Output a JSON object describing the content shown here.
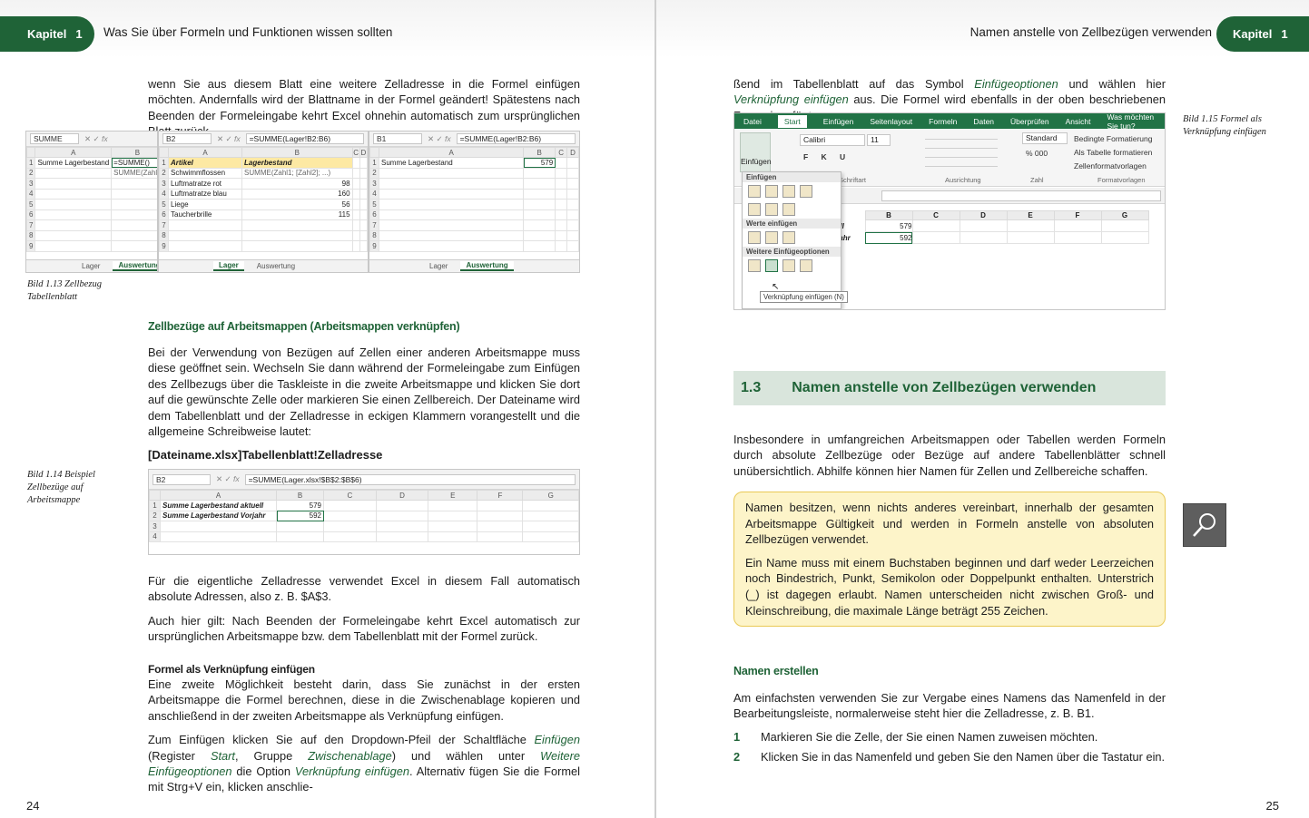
{
  "left_page": {
    "chapter_label": "Kapitel",
    "chapter_number": "1",
    "header_title": "Was Sie über Formeln und Funktionen wissen sollten",
    "intro_paragraph": "wenn Sie aus diesem Blatt eine weitere Zelladresse in die Formel einfügen möchten. Andernfalls wird der Blattname in der Formel geändert! Spätestens nach Beenden der Formeleingabe kehrt Excel ohnehin automatisch zum ursprünglichen Blatt zurück.",
    "fig113": {
      "caption": "Bild 1.13 Zellbezug Tabellenblatt",
      "panel1": {
        "namebox": "SUMME",
        "formula": "",
        "headers": [
          "A",
          "B"
        ],
        "rows": [
          [
            "1",
            "Summe Lagerbestand",
            "=SUMME()"
          ],
          [
            "2",
            "",
            "SUMME(Zahl1"
          ],
          [
            "3",
            "",
            ""
          ],
          [
            "4",
            "",
            ""
          ],
          [
            "5",
            "",
            ""
          ],
          [
            "6",
            "",
            ""
          ],
          [
            "7",
            "",
            ""
          ],
          [
            "8",
            "",
            ""
          ],
          [
            "9",
            "",
            ""
          ]
        ],
        "tabs": [
          "Lager",
          "Auswertung"
        ]
      },
      "panel2": {
        "namebox": "B2",
        "formula": "=SUMME(Lager!B2:B6)",
        "headers": [
          "A",
          "B",
          "C",
          "D"
        ],
        "rows": [
          [
            "1",
            "Artikel",
            "Lagerbestand",
            "",
            ""
          ],
          [
            "2",
            "Schwimmflossen",
            "SUMME(Zahl1; [Zahl2]; ...)",
            "",
            ""
          ],
          [
            "3",
            "Luftmatratze rot",
            "98",
            "",
            ""
          ],
          [
            "4",
            "Luftmatratze blau",
            "160",
            "",
            ""
          ],
          [
            "5",
            "Liege",
            "56",
            "",
            ""
          ],
          [
            "6",
            "Taucherbrille",
            "115",
            "",
            ""
          ],
          [
            "7",
            "",
            "",
            "",
            ""
          ],
          [
            "8",
            "",
            "",
            "",
            ""
          ],
          [
            "9",
            "",
            "",
            "",
            ""
          ]
        ],
        "tabs": [
          "Lager",
          "Auswertung"
        ]
      },
      "panel3": {
        "namebox": "B1",
        "formula": "=SUMME(Lager!B2:B6)",
        "headers": [
          "A",
          "B",
          "C",
          "D"
        ],
        "rows": [
          [
            "1",
            "Summe Lagerbestand",
            "579",
            "",
            ""
          ],
          [
            "2",
            "",
            "",
            "",
            ""
          ],
          [
            "3",
            "",
            "",
            "",
            ""
          ],
          [
            "4",
            "",
            "",
            "",
            ""
          ],
          [
            "5",
            "",
            "",
            "",
            ""
          ],
          [
            "6",
            "",
            "",
            "",
            ""
          ],
          [
            "7",
            "",
            "",
            "",
            ""
          ],
          [
            "8",
            "",
            "",
            "",
            ""
          ],
          [
            "9",
            "",
            "",
            "",
            ""
          ]
        ],
        "tabs": [
          "Lager",
          "Auswertung"
        ]
      }
    },
    "subhead1": "Zellbezüge auf Arbeitsmappen (Arbeitsmappen verknüpfen)",
    "para1": "Bei der Verwendung von Bezügen auf Zellen einer anderen Arbeitsmappe muss diese geöffnet sein. Wechseln Sie dann während der Formeleingabe zum Einfügen des Zellbezugs über die Taskleiste in die zweite Arbeitsmappe und klicken Sie dort auf die gewünschte Zelle oder markieren Sie einen Zellbereich. Der Dateiname wird dem Tabellenblatt und der Zelladresse in eckigen Klammern vorangestellt und die allgemeine Schreibweise lautet:",
    "syntax": "[Dateiname.xlsx]Tabellenblatt!Zelladresse",
    "fig114": {
      "caption": "Bild 1.14 Beispiel Zellbezüge auf Arbeitsmappe",
      "namebox": "B2",
      "formula": "=SUMME(Lager.xlsx!$B$2:$B$6)",
      "headers": [
        "A",
        "B",
        "C",
        "D",
        "E",
        "F",
        "G"
      ],
      "rows": [
        [
          "1",
          "Summe Lagerbestand aktuell",
          "579"
        ],
        [
          "2",
          "Summe Lagerbestand Vorjahr",
          "592"
        ],
        [
          "3",
          "",
          ""
        ],
        [
          "4",
          "",
          ""
        ]
      ]
    },
    "para2": "Für die eigentliche Zelladresse verwendet Excel in diesem Fall automatisch absolute Adressen, also z. B. $A$3.",
    "para3": "Auch hier gilt: Nach Beenden der Formeleingabe kehrt Excel automatisch zur ursprünglichen Arbeitsmappe bzw. dem Tabellenblatt mit der Formel zurück.",
    "subhead2": "Formel als Verknüpfung einfügen",
    "para4": "Eine zweite Möglichkeit besteht darin, dass Sie zunächst in der ersten Arbeitsmappe die Formel berechnen, diese in die Zwischenablage kopieren und anschließend in der zweiten Arbeitsmappe als Verknüpfung einfügen.",
    "para5_a": "Zum Einfügen klicken Sie auf den Dropdown-Pfeil der Schaltfläche ",
    "para5_b": "Einfügen",
    "para5_c": " (Register ",
    "para5_d": "Start",
    "para5_e": ", Gruppe ",
    "para5_f": "Zwischenablage",
    "para5_g": ") und wählen unter ",
    "para5_h": "Weitere Einfügeoptionen",
    "para5_i": " die Option ",
    "para5_j": "Verknüpfung einfügen",
    "para5_k": ". Alternativ fügen Sie die Formel mit Strg+V ein, klicken anschlie-",
    "page_number": "24"
  },
  "right_page": {
    "chapter_label": "Kapitel",
    "chapter_number": "1",
    "header_title": "Namen anstelle von Zellbezügen verwenden",
    "cont_a": "ßend im Tabellenblatt auf das Symbol ",
    "cont_b": "Einfügeoptionen",
    "cont_c": " und wählen hier ",
    "cont_d": "Verknüpfung einfügen",
    "cont_e": " aus. Die Formel wird ebenfalls in der oben beschriebenen Form eingefügt.",
    "fig115": {
      "caption": "Bild 1.15 Formel als Verknüpfung einfügen",
      "ribbon_tabs": [
        "Datei",
        "Start",
        "Einfügen",
        "Seitenlayout",
        "Formeln",
        "Daten",
        "Überprüfen",
        "Ansicht",
        "Was möchten Sie tun?"
      ],
      "paste_button": "Einfügen",
      "font_name": "Calibri",
      "font_size": "11",
      "number_format": "Standard",
      "styles": [
        "Bedingte Formatierung",
        "Als Tabelle formatieren",
        "Zellenformatvorlagen"
      ],
      "group_labels": [
        "Schriftart",
        "Ausrichtung",
        "Zahl",
        "Formatvorlagen"
      ],
      "menu_heads": [
        "Einfügen",
        "Werte einfügen",
        "Weitere Einfügeoptionen"
      ],
      "tooltip": "Verknüpfung einfügen (N)",
      "col_headers": [
        "B",
        "C",
        "D",
        "E",
        "F",
        "G"
      ],
      "rows": [
        [
          "ktuell",
          "579"
        ],
        [
          "Vorjahr",
          "592"
        ]
      ]
    },
    "section_number": "1.3",
    "section_title": "Namen anstelle von Zellbezügen verwenden",
    "para1": "Insbesondere in umfangreichen Arbeitsmappen oder Tabellen werden Formeln durch absolute Zellbezüge oder Bezüge auf andere Tabellenblätter schnell unübersichtlich. Abhilfe können hier Namen für Zellen und Zellbereiche schaffen.",
    "note1": "Namen besitzen, wenn nichts anderes vereinbart, innerhalb der gesamten Arbeitsmappe Gültigkeit und werden in Formeln anstelle von absoluten Zellbezügen verwendet.",
    "note2": "Ein Name muss mit einem Buchstaben beginnen und darf weder Leerzeichen noch Bindestrich, Punkt, Semikolon oder Doppelpunkt enthalten. Unterstrich (_) ist dagegen erlaubt. Namen unterscheiden nicht zwischen Groß- und Kleinschreibung, die maximale Länge beträgt 255 Zeichen.",
    "subhead": "Namen erstellen",
    "para2": "Am einfachsten verwenden Sie zur Vergabe eines Namens das Namenfeld in der Bearbeitungsleiste, normalerweise steht hier die Zelladresse, z. B. B1.",
    "steps": [
      {
        "n": "1",
        "text": "Markieren Sie die Zelle, der Sie einen Namen zuweisen möchten."
      },
      {
        "n": "2",
        "text": "Klicken Sie in das Namenfeld und geben Sie den Namen über die Tastatur ein."
      }
    ],
    "page_number": "25"
  },
  "colors": {
    "accent_green": "#1f6337",
    "excel_green": "#217346",
    "note_bg": "#fdf4c9",
    "note_border": "#e9c955",
    "section_bg": "#d9e5dc"
  }
}
